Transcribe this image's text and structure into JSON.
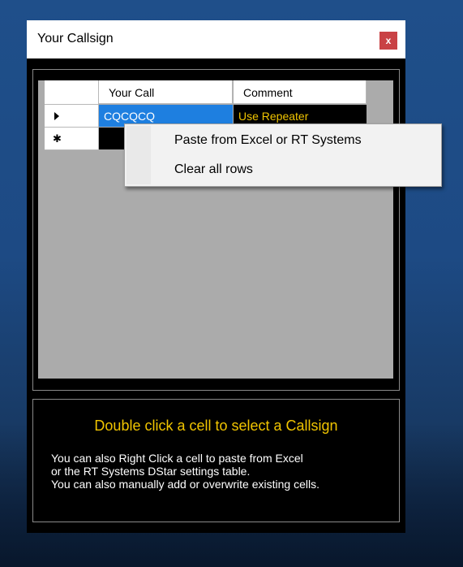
{
  "window": {
    "title": "Your Callsign",
    "close_label": "x"
  },
  "grid": {
    "columns": [
      "Your Call",
      "Comment"
    ],
    "rows": [
      {
        "your_call": "CQCQCQ",
        "comment": "Use Repeater"
      }
    ]
  },
  "context_menu": {
    "items": [
      "Paste from Excel or RT Systems",
      "Clear all rows"
    ]
  },
  "info": {
    "heading": "Double click a cell to select a Callsign",
    "lines": [
      "You can also Right Click a cell to paste from Excel",
      "or the RT Systems DStar settings table.",
      "You can also manually add or overwrite existing cells."
    ]
  },
  "colors": {
    "selection_blue": "#1e7fe0",
    "comment_yellow": "#f0c400",
    "close_red": "#c94245"
  }
}
